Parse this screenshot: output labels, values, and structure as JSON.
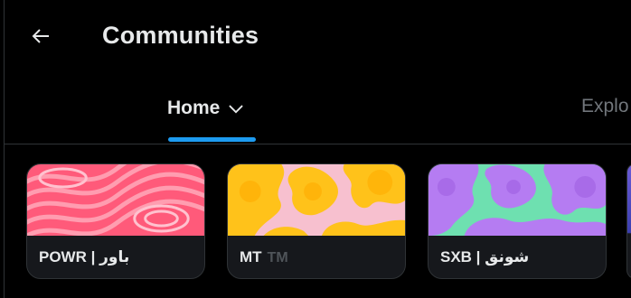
{
  "header": {
    "title": "Communities",
    "back_icon": "arrow-left-icon"
  },
  "tabs": {
    "home": {
      "label": "Home",
      "icon": "chevron-down-icon",
      "selected": true
    },
    "explore": {
      "label": "Explo"
    }
  },
  "colors": {
    "background": "#000000",
    "accent": "#1d9bf0",
    "text": "#e7e9ea",
    "muted": "#71767b",
    "divider": "#2f3336",
    "card_bg": "#16181c"
  },
  "communities": [
    {
      "name": "POWR | باور",
      "art": "pink-swirl"
    },
    {
      "name": "MT",
      "badge": "TM",
      "art": "yellow-blobs"
    },
    {
      "name": "SXB | شونق",
      "art": "purple-blobs"
    }
  ]
}
